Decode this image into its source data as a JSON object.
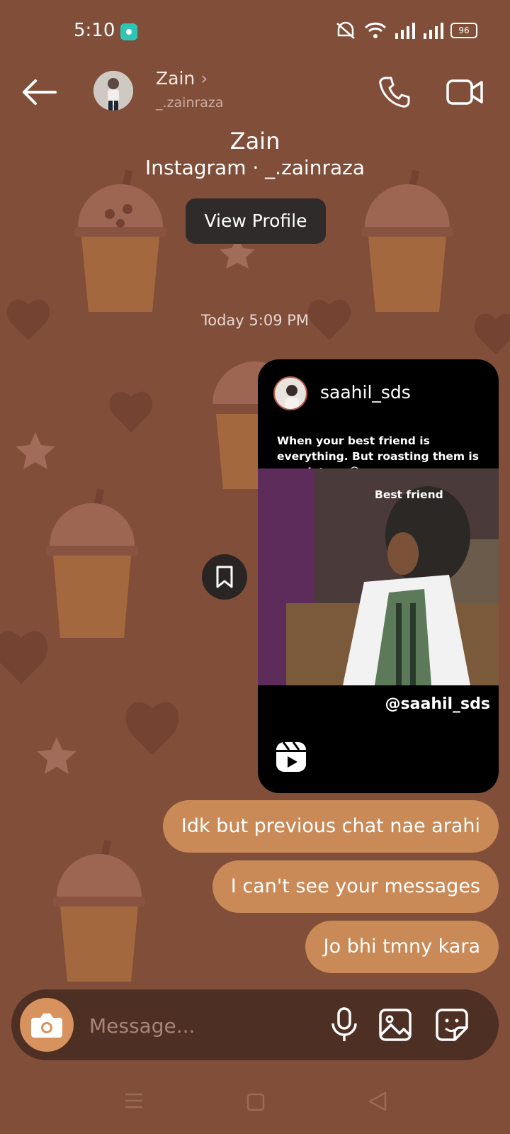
{
  "status_bar": {
    "time": "5:10",
    "battery": "96"
  },
  "header": {
    "name": "Zain",
    "username": "_.zainraza"
  },
  "profile": {
    "name": "Zain",
    "subtitle": "Instagram · _.zainraza",
    "view_profile_label": "View Profile"
  },
  "timestamp": "Today 5:09 PM",
  "shared_post": {
    "username": "saahil_sds",
    "caption": "When your best friend is everything. But roasting them is mandatory 😂",
    "media_overlay": "Best friend",
    "handle": "@saahil_sds"
  },
  "messages": [
    {
      "text": "Idk but previous chat nae arahi"
    },
    {
      "text": "I can't see your messages"
    },
    {
      "text": "Jo bhi tmny kara"
    }
  ],
  "composer": {
    "placeholder": "Message..."
  },
  "colors": {
    "background": "#814e3a",
    "bubble": "#c98a57",
    "composer": "#4e2f24",
    "camera_button": "#d7925d"
  }
}
